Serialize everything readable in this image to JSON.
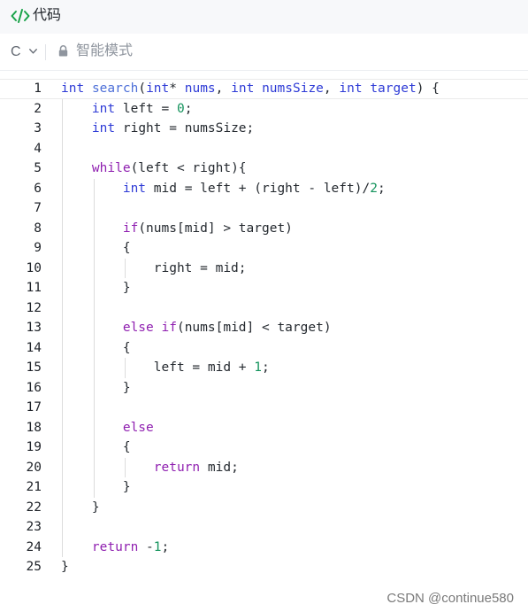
{
  "header": {
    "title": "代码",
    "icon": "code-icon"
  },
  "toolbar": {
    "language": "C",
    "mode": "智能模式",
    "mode_icon": "lock-icon"
  },
  "editor": {
    "lines": [
      {
        "n": "1",
        "tokens": [
          [
            "kw",
            "int"
          ],
          [
            "id",
            " "
          ],
          [
            "fn",
            "search"
          ],
          [
            "id",
            "("
          ],
          [
            "kw",
            "int"
          ],
          [
            "id",
            "* "
          ],
          [
            "kw",
            "nums"
          ],
          [
            "id",
            ", "
          ],
          [
            "kw",
            "int"
          ],
          [
            "id",
            " "
          ],
          [
            "kw",
            "numsSize"
          ],
          [
            "id",
            ", "
          ],
          [
            "kw",
            "int"
          ],
          [
            "id",
            " "
          ],
          [
            "kw",
            "target"
          ],
          [
            "id",
            ") {"
          ]
        ]
      },
      {
        "n": "2",
        "tokens": [
          [
            "id",
            "    "
          ],
          [
            "kw",
            "int"
          ],
          [
            "id",
            " left = "
          ],
          [
            "num",
            "0"
          ],
          [
            "id",
            ";"
          ]
        ]
      },
      {
        "n": "3",
        "tokens": [
          [
            "id",
            "    "
          ],
          [
            "kw",
            "int"
          ],
          [
            "id",
            " right = numsSize;"
          ]
        ]
      },
      {
        "n": "4",
        "tokens": []
      },
      {
        "n": "5",
        "tokens": [
          [
            "id",
            "    "
          ],
          [
            "ct",
            "while"
          ],
          [
            "id",
            "(left < right){"
          ]
        ]
      },
      {
        "n": "6",
        "tokens": [
          [
            "id",
            "        "
          ],
          [
            "kw",
            "int"
          ],
          [
            "id",
            " mid = left + (right - left)/"
          ],
          [
            "num",
            "2"
          ],
          [
            "id",
            ";"
          ]
        ]
      },
      {
        "n": "7",
        "tokens": []
      },
      {
        "n": "8",
        "tokens": [
          [
            "id",
            "        "
          ],
          [
            "ct",
            "if"
          ],
          [
            "id",
            "(nums[mid] > target)"
          ]
        ]
      },
      {
        "n": "9",
        "tokens": [
          [
            "id",
            "        {"
          ]
        ]
      },
      {
        "n": "10",
        "tokens": [
          [
            "id",
            "            right = mid;"
          ]
        ]
      },
      {
        "n": "11",
        "tokens": [
          [
            "id",
            "        }"
          ]
        ]
      },
      {
        "n": "12",
        "tokens": []
      },
      {
        "n": "13",
        "tokens": [
          [
            "id",
            "        "
          ],
          [
            "ct",
            "else"
          ],
          [
            "id",
            " "
          ],
          [
            "ct",
            "if"
          ],
          [
            "id",
            "(nums[mid] < target)"
          ]
        ]
      },
      {
        "n": "14",
        "tokens": [
          [
            "id",
            "        {"
          ]
        ]
      },
      {
        "n": "15",
        "tokens": [
          [
            "id",
            "            left = mid + "
          ],
          [
            "num",
            "1"
          ],
          [
            "id",
            ";"
          ]
        ]
      },
      {
        "n": "16",
        "tokens": [
          [
            "id",
            "        }"
          ]
        ]
      },
      {
        "n": "17",
        "tokens": []
      },
      {
        "n": "18",
        "tokens": [
          [
            "id",
            "        "
          ],
          [
            "ct",
            "else"
          ]
        ]
      },
      {
        "n": "19",
        "tokens": [
          [
            "id",
            "        {"
          ]
        ]
      },
      {
        "n": "20",
        "tokens": [
          [
            "id",
            "            "
          ],
          [
            "ct",
            "return"
          ],
          [
            "id",
            " mid;"
          ]
        ]
      },
      {
        "n": "21",
        "tokens": [
          [
            "id",
            "        }"
          ]
        ]
      },
      {
        "n": "22",
        "tokens": [
          [
            "id",
            "    }"
          ]
        ]
      },
      {
        "n": "23",
        "tokens": []
      },
      {
        "n": "24",
        "tokens": [
          [
            "id",
            "    "
          ],
          [
            "ct",
            "return"
          ],
          [
            "id",
            " -"
          ],
          [
            "num",
            "1"
          ],
          [
            "id",
            ";"
          ]
        ]
      },
      {
        "n": "25",
        "tokens": [
          [
            "id",
            "}"
          ]
        ]
      }
    ]
  },
  "watermark": "CSDN @continue580"
}
